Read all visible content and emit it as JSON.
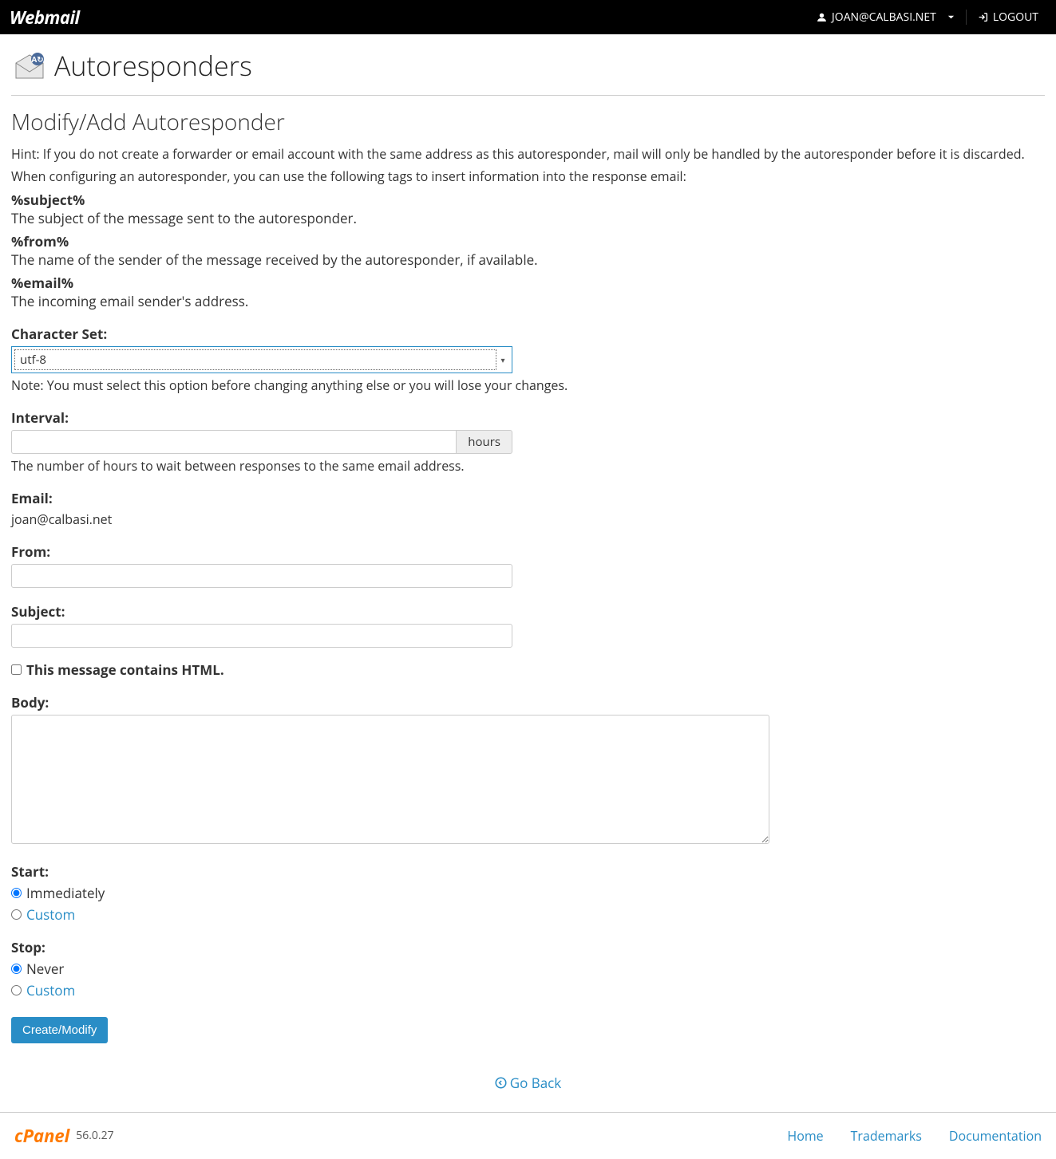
{
  "header": {
    "logo": "Webmail",
    "user": "JOAN@CALBASI.NET",
    "logout": "LOGOUT"
  },
  "page": {
    "title": "Autoresponders",
    "section_title": "Modify/Add Autoresponder",
    "hint": "Hint: If you do not create a forwarder or email account with the same address as this autoresponder, mail will only be handled by the autoresponder before it is discarded.",
    "tags_intro": "When configuring an autoresponder, you can use the following tags to insert information into the response email:",
    "tags": [
      {
        "name": "%subject%",
        "desc": "The subject of the message sent to the autoresponder."
      },
      {
        "name": "%from%",
        "desc": "The name of the sender of the message received by the autoresponder, if available."
      },
      {
        "name": "%email%",
        "desc": "The incoming email sender's address."
      }
    ]
  },
  "form": {
    "charset": {
      "label": "Character Set:",
      "value": "utf-8",
      "note": "Note: You must select this option before changing anything else or you will lose your changes."
    },
    "interval": {
      "label": "Interval:",
      "value": "",
      "unit": "hours",
      "help": "The number of hours to wait between responses to the same email address."
    },
    "email": {
      "label": "Email:",
      "value": "joan@calbasi.net"
    },
    "from": {
      "label": "From:",
      "value": ""
    },
    "subject": {
      "label": "Subject:",
      "value": ""
    },
    "html_checkbox": {
      "label": "This message contains HTML.",
      "checked": false
    },
    "body": {
      "label": "Body:",
      "value": ""
    },
    "start": {
      "label": "Start:",
      "options": [
        {
          "label": "Immediately",
          "selected": true,
          "link": false
        },
        {
          "label": "Custom",
          "selected": false,
          "link": true
        }
      ]
    },
    "stop": {
      "label": "Stop:",
      "options": [
        {
          "label": "Never",
          "selected": true,
          "link": false
        },
        {
          "label": "Custom",
          "selected": false,
          "link": true
        }
      ]
    },
    "submit": "Create/Modify"
  },
  "nav": {
    "go_back": "Go Back"
  },
  "footer": {
    "brand": "cPanel",
    "version": "56.0.27",
    "links": [
      "Home",
      "Trademarks",
      "Documentation"
    ]
  }
}
